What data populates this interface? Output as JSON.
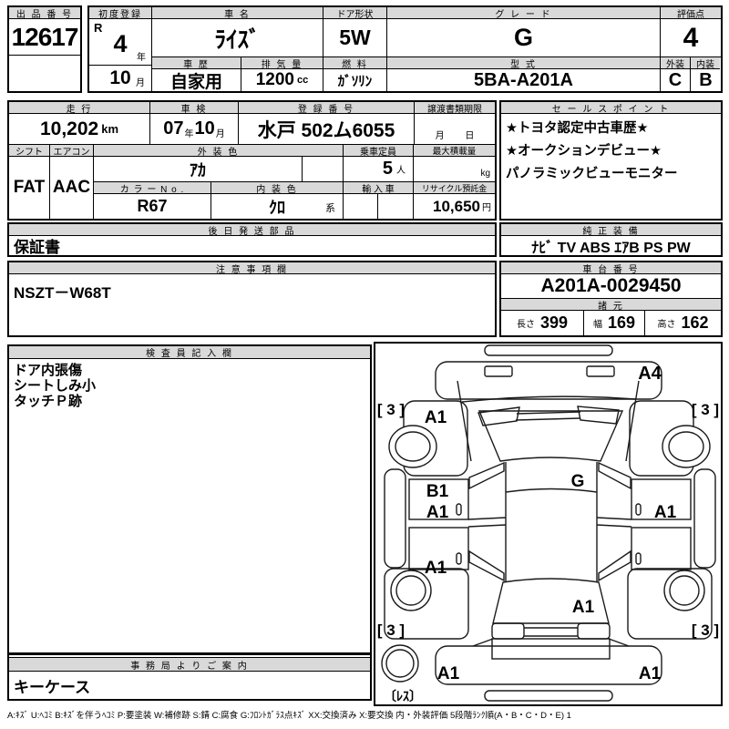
{
  "header": {
    "auction_no": {
      "label": "出 品 番 号",
      "value": "12617"
    },
    "first_reg": {
      "label": "初度登録",
      "era": "R",
      "year": "4",
      "year_unit": "年",
      "month": "10",
      "month_unit": "月"
    },
    "car_name": {
      "label": "車  名",
      "value": "ﾗｲｽﾞ"
    },
    "door": {
      "label": "ドア形状",
      "value": "5W"
    },
    "grade": {
      "label": "グ レ ー ド",
      "value": "G"
    },
    "score": {
      "label": "評価点",
      "value": "4"
    },
    "history": {
      "label": "車 歴",
      "value": "自家用"
    },
    "displacement": {
      "label": "排 気 量",
      "value": "1200",
      "unit": "cc"
    },
    "fuel": {
      "label": "燃 料",
      "value": "ｶﾞｿﾘﾝ"
    },
    "model_code": {
      "label": "型 式",
      "value": "5BA-A201A"
    },
    "exterior": {
      "label": "外装",
      "value": "C"
    },
    "interior": {
      "label": "内装",
      "value": "B"
    }
  },
  "specs": {
    "mileage": {
      "label": "走 行",
      "value": "10,202",
      "unit": "km"
    },
    "inspection": {
      "label": "車 検",
      "year": "07",
      "year_unit": "年",
      "month": "10",
      "month_unit": "月"
    },
    "reg_no": {
      "label": "登 録 番 号",
      "value": "水戸 502ム6055"
    },
    "transfer": {
      "label": "譲渡書類期限",
      "month_label": "月",
      "day_label": "日"
    },
    "shift": {
      "label": "シフト",
      "value": "FAT"
    },
    "aircon": {
      "label": "エアコン",
      "value": "AAC"
    },
    "ext_color": {
      "label": "外 装 色",
      "value": "ｱｶ"
    },
    "capacity": {
      "label": "乗車定員",
      "value": "5",
      "unit": "人"
    },
    "max_load": {
      "label": "最大積載量",
      "unit": "kg"
    },
    "color_no": {
      "label": "カ ラ ー N o .",
      "value": "R67"
    },
    "int_color": {
      "label": "内 装 色",
      "value": "ｸﾛ",
      "suffix": "系"
    },
    "import": {
      "label": "輸 入 車"
    },
    "recycle": {
      "label": "リサイクル預託金",
      "value": "10,650",
      "unit": "円"
    }
  },
  "later_parts": {
    "label": "後 日 発 送 部 品",
    "value": "保証書"
  },
  "notes": {
    "label": "注 意 事 項 欄",
    "value": "NSZT－W68T"
  },
  "sales_points": {
    "label": "セ ー ル ス ポ イ ン ト",
    "lines": [
      "★トヨタ認定中古車歴★",
      "★オークションデビュー★",
      "パノラミックビューモニター"
    ]
  },
  "equipment": {
    "label": "純 正 装 備",
    "value": "ﾅﾋﾞ TV ABS ｴｱB PS PW"
  },
  "chassis": {
    "label": "車 台 番 号",
    "value": "A201A-0029450"
  },
  "dimensions": {
    "label": "諸 元",
    "length_label": "長さ",
    "length": "399",
    "width_label": "幅",
    "width": "169",
    "height_label": "高さ",
    "height": "162"
  },
  "inspector": {
    "label": "検 査 員 記 入 欄",
    "lines": [
      "ドア内張傷",
      "シートしみ小",
      "タッチＰ跡"
    ]
  },
  "office": {
    "label": "事 務 局 よ り ご 案 内",
    "value": "キーケース"
  },
  "diagram": {
    "labels": {
      "front_bumper": "A4",
      "tire_fl": "[ 3 ]",
      "tire_fr": "[ 3 ]",
      "fender_fl": "A1",
      "glass": "G",
      "door_fl_top": "B1",
      "door_fl": "A1",
      "door_fr": "A1",
      "door_rl": "A1",
      "rear_gate": "A1",
      "tire_rl": "[ 3 ]",
      "tire_rr": "[ 3 ]",
      "rear_bumper_l": "A1",
      "rear_bumper_r": "A1",
      "spare": "〔ﾚｽ〕"
    }
  },
  "legend": "A:ｷｽﾞ U:ﾍｺﾐ B:ｷｽﾞを伴うﾍｺﾐ P:要塗装 W:補修跡 S:錆 C:腐食 G:ﾌﾛﾝﾄｶﾞﾗｽ点ｷｽﾞ XX:交換済み X:要交換  内・外装評価  5段階ﾗﾝｸ順(A・B・C・D・E) 1"
}
